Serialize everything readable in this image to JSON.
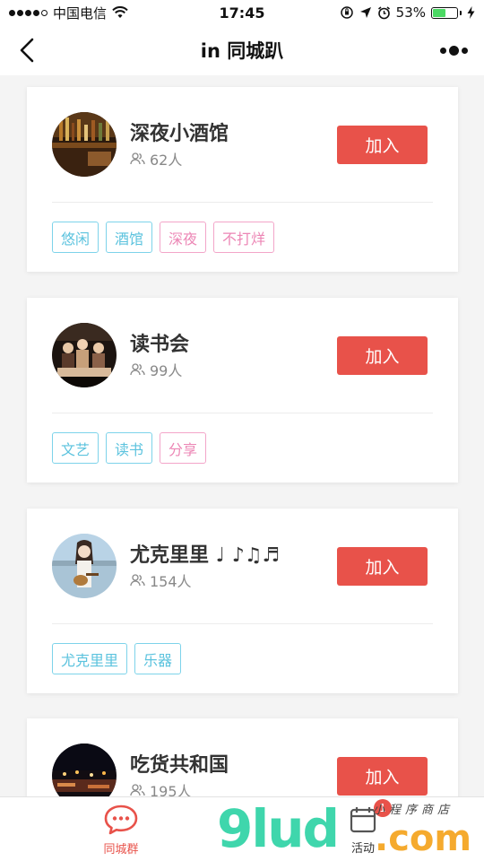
{
  "status_bar": {
    "carrier": "中国电信",
    "time": "17:45",
    "battery_percent": "53%",
    "battery_level": 0.53,
    "signal_bars_filled": 4,
    "signal_bars_total": 5
  },
  "nav": {
    "title": "in 同城趴"
  },
  "groups": [
    {
      "name": "深夜小酒馆",
      "members": "62人",
      "join_label": "加入",
      "tags": [
        {
          "text": "悠闲",
          "color": "blue"
        },
        {
          "text": "酒馆",
          "color": "blue"
        },
        {
          "text": "深夜",
          "color": "pink"
        },
        {
          "text": "不打烊",
          "color": "pink"
        }
      ]
    },
    {
      "name": "读书会",
      "members": "99人",
      "join_label": "加入",
      "tags": [
        {
          "text": "文艺",
          "color": "blue"
        },
        {
          "text": "读书",
          "color": "blue"
        },
        {
          "text": "分享",
          "color": "pink"
        }
      ]
    },
    {
      "name": "尤克里里 ♩ ♪♫♬",
      "members": "154人",
      "join_label": "加入",
      "tags": [
        {
          "text": "尤克里里",
          "color": "blue"
        },
        {
          "text": "乐器",
          "color": "blue"
        }
      ]
    },
    {
      "name": "吃货共和国",
      "members": "195人",
      "join_label": "加入",
      "tags": []
    }
  ],
  "tab_bar": {
    "tabs": [
      {
        "label": "同城群",
        "icon": "chat-bubble-icon",
        "active": true
      },
      {
        "label": "活动",
        "icon": "activity-icon",
        "active": false,
        "badge": "1"
      }
    ]
  },
  "watermark": {
    "logo": "9lud",
    "domain": ".com",
    "subtitle": "小程序商店"
  },
  "colors": {
    "accent": "#e8524a",
    "tag_blue": "#5cc3de",
    "tag_pink": "#ec86b5",
    "battery": "#4cd964"
  }
}
